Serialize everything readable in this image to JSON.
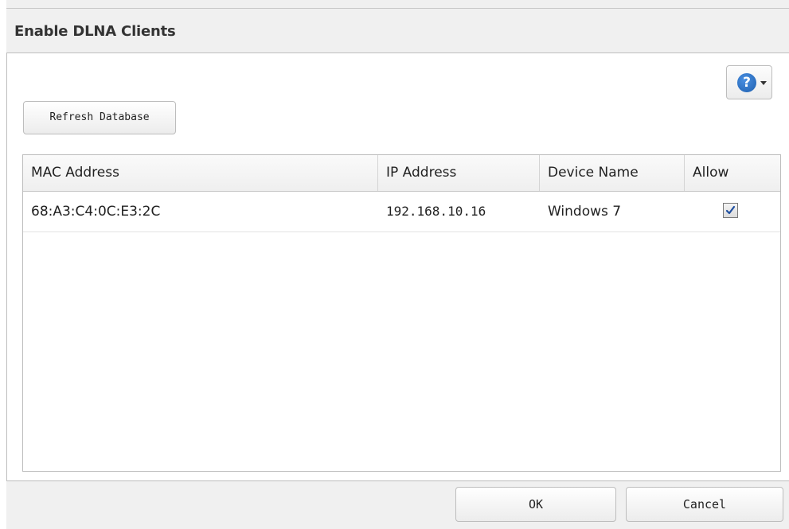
{
  "dialog": {
    "title": "Enable DLNA Clients"
  },
  "toolbar": {
    "refresh_label": "Refresh Database",
    "help_icon": "?"
  },
  "table": {
    "columns": [
      "MAC Address",
      "IP Address",
      "Device Name",
      "Allow"
    ],
    "rows": [
      {
        "mac": "68:A3:C4:0C:E3:2C",
        "ip": "192.168.10.16",
        "device": "Windows 7",
        "allow": true
      }
    ]
  },
  "footer": {
    "ok_label": "OK",
    "cancel_label": "Cancel"
  },
  "colors": {
    "help_icon": "#1e5fae",
    "dialog_bg": "#f0f0f0",
    "border": "#bdbdbd"
  }
}
